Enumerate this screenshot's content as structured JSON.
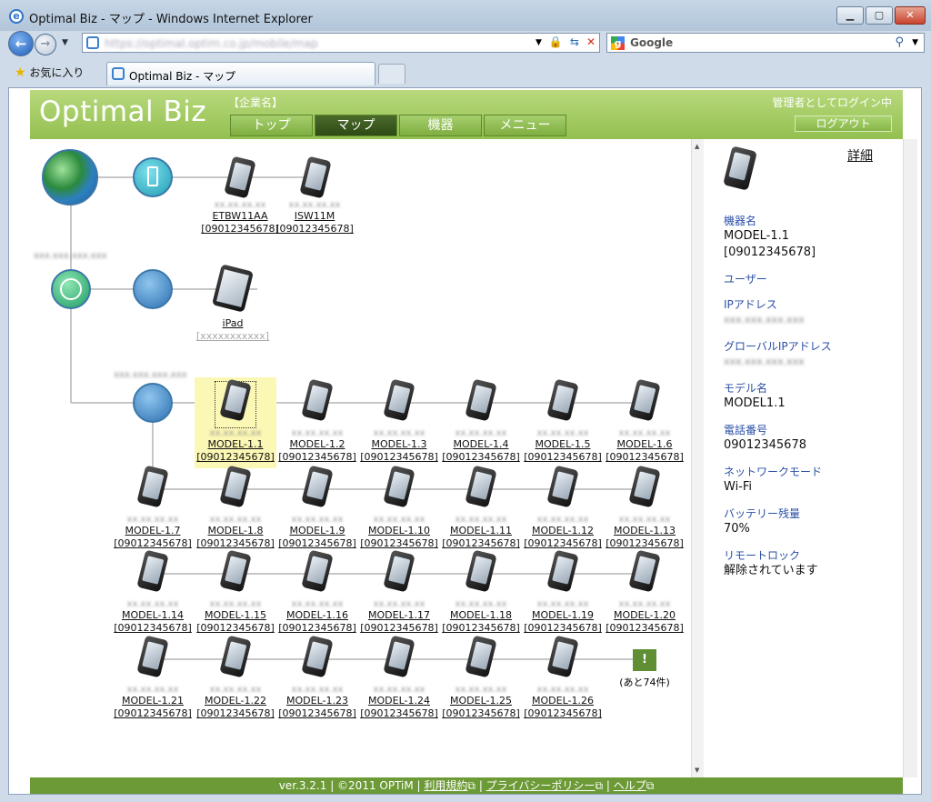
{
  "window": {
    "title": "Optimal Biz - マップ - Windows Internet Explorer",
    "min_icon": "minimize-icon",
    "max_icon": "maximize-icon",
    "close_icon": "close-icon"
  },
  "address": {
    "url": "https://optimal.optim.co.jp/mobile/map"
  },
  "search": {
    "placeholder": "Google"
  },
  "favorites": {
    "label": "お気に入り"
  },
  "tab": {
    "label": "Optimal Biz - マップ"
  },
  "header": {
    "logo": "Optimal Biz",
    "company": "【企業名】",
    "login_info": "管理者としてログイン中",
    "logout": "ログアウト",
    "nav": [
      "トップ",
      "マップ",
      "機器",
      "メニュー"
    ]
  },
  "map": {
    "top_devices": [
      {
        "name": "ETBW11AA",
        "phone": "[09012345678]",
        "ip": "xx.xx.xx.xx"
      },
      {
        "name": "ISW11M",
        "phone": "[09012345678]",
        "ip": "xx.xx.xx.xx"
      }
    ],
    "gateway_ip": "xxx.xxx.xxx.xxx",
    "subnet_ip": "xxx.xxx.xxx.xxx",
    "ipad": {
      "name": "iPad",
      "phone": "[xxxxxxxxxxx]"
    },
    "devices": [
      {
        "name": "MODEL-1.1",
        "phone": "[09012345678]",
        "ip": "xx.xx.xx.xx"
      },
      {
        "name": "MODEL-1.2",
        "phone": "[09012345678]",
        "ip": "xx.xx.xx.xx"
      },
      {
        "name": "MODEL-1.3",
        "phone": "[09012345678]",
        "ip": "xx.xx.xx.xx"
      },
      {
        "name": "MODEL-1.4",
        "phone": "[09012345678]",
        "ip": "xx.xx.xx.xx"
      },
      {
        "name": "MODEL-1.5",
        "phone": "[09012345678]",
        "ip": "xx.xx.xx.xx"
      },
      {
        "name": "MODEL-1.6",
        "phone": "[09012345678]",
        "ip": "xx.xx.xx.xx"
      },
      {
        "name": "MODEL-1.7",
        "phone": "[09012345678]",
        "ip": "xx.xx.xx.xx"
      },
      {
        "name": "MODEL-1.8",
        "phone": "[09012345678]",
        "ip": "xx.xx.xx.xx"
      },
      {
        "name": "MODEL-1.9",
        "phone": "[09012345678]",
        "ip": "xx.xx.xx.xx"
      },
      {
        "name": "MODEL-1.10",
        "phone": "[09012345678]",
        "ip": "xx.xx.xx.xx"
      },
      {
        "name": "MODEL-1.11",
        "phone": "[09012345678]",
        "ip": "xx.xx.xx.xx"
      },
      {
        "name": "MODEL-1.12",
        "phone": "[09012345678]",
        "ip": "xx.xx.xx.xx"
      },
      {
        "name": "MODEL-1.13",
        "phone": "[09012345678]",
        "ip": "xx.xx.xx.xx"
      },
      {
        "name": "MODEL-1.14",
        "phone": "[09012345678]",
        "ip": "xx.xx.xx.xx"
      },
      {
        "name": "MODEL-1.15",
        "phone": "[09012345678]",
        "ip": "xx.xx.xx.xx"
      },
      {
        "name": "MODEL-1.16",
        "phone": "[09012345678]",
        "ip": "xx.xx.xx.xx"
      },
      {
        "name": "MODEL-1.17",
        "phone": "[09012345678]",
        "ip": "xx.xx.xx.xx"
      },
      {
        "name": "MODEL-1.18",
        "phone": "[09012345678]",
        "ip": "xx.xx.xx.xx"
      },
      {
        "name": "MODEL-1.19",
        "phone": "[09012345678]",
        "ip": "xx.xx.xx.xx"
      },
      {
        "name": "MODEL-1.20",
        "phone": "[09012345678]",
        "ip": "xx.xx.xx.xx"
      },
      {
        "name": "MODEL-1.21",
        "phone": "[09012345678]",
        "ip": "xx.xx.xx.xx"
      },
      {
        "name": "MODEL-1.22",
        "phone": "[09012345678]",
        "ip": "xx.xx.xx.xx"
      },
      {
        "name": "MODEL-1.23",
        "phone": "[09012345678]",
        "ip": "xx.xx.xx.xx"
      },
      {
        "name": "MODEL-1.24",
        "phone": "[09012345678]",
        "ip": "xx.xx.xx.xx"
      },
      {
        "name": "MODEL-1.25",
        "phone": "[09012345678]",
        "ip": "xx.xx.xx.xx"
      },
      {
        "name": "MODEL-1.26",
        "phone": "[09012345678]",
        "ip": "xx.xx.xx.xx"
      }
    ],
    "more_icon": "!",
    "more_label": "(あと74件)"
  },
  "side": {
    "detail_link": "詳細",
    "fields": [
      {
        "label": "機器名",
        "value": "MODEL-1.1\n[09012345678]"
      },
      {
        "label": "ユーザー",
        "value": ""
      },
      {
        "label": "IPアドレス",
        "value": "xxx.xxx.xxx.xxx",
        "blur": true
      },
      {
        "label": "グローバルIPアドレス",
        "value": "xxx.xxx.xxx.xxx",
        "blur": true
      },
      {
        "label": "モデル名",
        "value": "MODEL1.1"
      },
      {
        "label": "電話番号",
        "value": "09012345678"
      },
      {
        "label": "ネットワークモード",
        "value": "Wi-Fi"
      },
      {
        "label": "バッテリー残量",
        "value": "70%"
      },
      {
        "label": "リモートロック",
        "value": "解除されています"
      }
    ]
  },
  "footer": {
    "version": "ver.3.2.1",
    "copyright": "©2011 OPTiM",
    "links": [
      "利用規約",
      "プライバシーポリシー",
      "ヘルプ"
    ]
  },
  "colors": {
    "header_green": "#93c050",
    "footer_green": "#6c9a36",
    "link_blue": "#2a4fa5",
    "selected": "#fbf7b4"
  }
}
